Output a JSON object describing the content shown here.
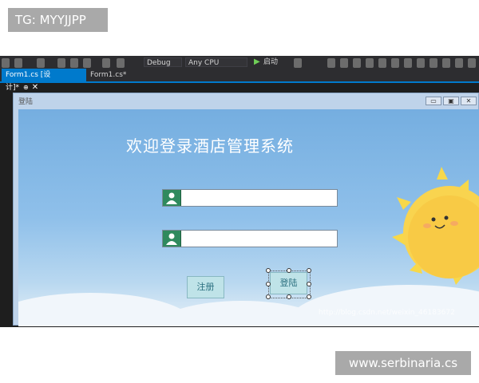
{
  "watermark": {
    "top": "TG: MYYJJPP",
    "bottom": "www.serbinaria.cs"
  },
  "ide": {
    "config_combo": "Debug",
    "platform_combo": "Any CPU",
    "start_label": "启动",
    "tabs": [
      {
        "label": "Form1.cs [设计]*",
        "active": true
      },
      {
        "label": "Form1.cs*",
        "active": false
      }
    ]
  },
  "form": {
    "title": "登陆",
    "headline": "欢迎登录酒店管理系统",
    "username_value": "",
    "password_value": "",
    "register_label": "注册",
    "login_label": "登陆",
    "blog_watermark": "http://blog.csdn.net/weixin_46183672"
  },
  "colors": {
    "accent": "#007acc",
    "field_icon": "#2f8a5e",
    "button_bg": "#bfe3e8",
    "sky": "#8fc0ea"
  }
}
